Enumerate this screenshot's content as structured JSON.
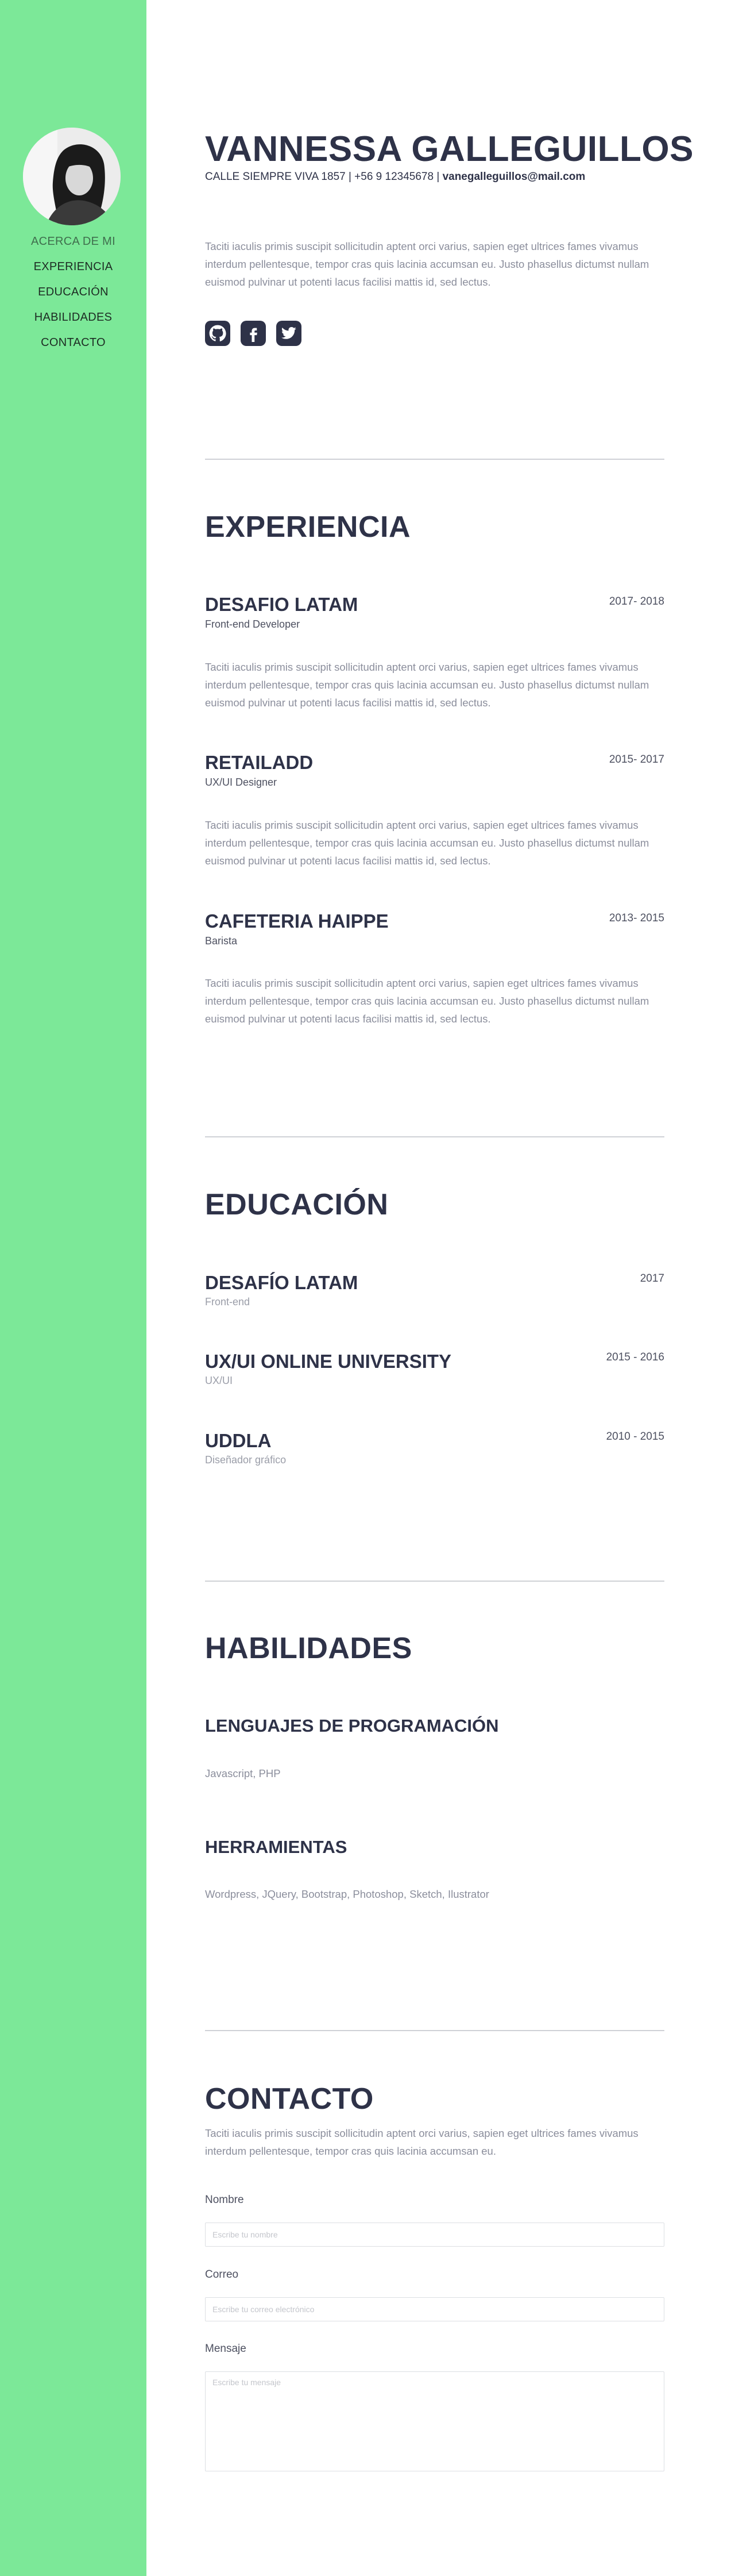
{
  "sidebar": {
    "nav": [
      {
        "label": "ACERCA DE MI"
      },
      {
        "label": "EXPERIENCIA"
      },
      {
        "label": "EDUCACIÓN"
      },
      {
        "label": "HABILIDADES"
      },
      {
        "label": "CONTACTO"
      }
    ],
    "bg_color": "#7ce898"
  },
  "header": {
    "name": "VANNESSA GALLEGUILLOS",
    "address": "CALLE SIEMPRE VIVA 1857",
    "sep1": " | ",
    "phone": "+56 9 12345678",
    "sep2": " | ",
    "email": "vanegalleguillos@mail.com",
    "bio": "Taciti iaculis primis suscipit sollicitudin aptent orci varius, sapien eget ultrices fames vivamus interdum pellentesque, tempor cras quis lacinia accumsan eu. Justo phasellus dictumst nullam euismod pulvinar ut potenti lacus facilisi mattis id, sed lectus.",
    "social_icons": [
      "github-icon",
      "facebook-icon",
      "twitter-icon"
    ]
  },
  "experience": {
    "title": "EXPERIENCIA",
    "items": [
      {
        "company": "DESAFIO LATAM",
        "role": "Front-end Developer",
        "dates": "2017- 2018",
        "description": "Taciti iaculis primis suscipit sollicitudin aptent orci varius, sapien eget ultrices fames vivamus interdum pellentesque, tempor cras quis lacinia accumsan eu. Justo phasellus dictumst nullam euismod pulvinar ut potenti lacus facilisi mattis id, sed lectus."
      },
      {
        "company": "RETAILADD",
        "role": "UX/UI Designer",
        "dates": "2015- 2017",
        "description": "Taciti iaculis primis suscipit sollicitudin aptent orci varius, sapien eget ultrices fames vivamus interdum pellentesque, tempor cras quis lacinia accumsan eu. Justo phasellus dictumst nullam euismod pulvinar ut potenti lacus facilisi mattis id, sed lectus."
      },
      {
        "company": "CAFETERIA HAIPPE",
        "role": "Barista",
        "dates": "2013- 2015",
        "description": "Taciti iaculis primis suscipit sollicitudin aptent orci varius, sapien eget ultrices fames vivamus interdum pellentesque, tempor cras quis lacinia accumsan eu. Justo phasellus dictumst nullam euismod pulvinar ut potenti lacus facilisi mattis id, sed lectus."
      }
    ]
  },
  "education": {
    "title": "EDUCACIÓN",
    "items": [
      {
        "school": "DESAFÍO LATAM",
        "field": "Front-end",
        "dates": "2017"
      },
      {
        "school": "UX/UI ONLINE UNIVERSITY",
        "field": "UX/UI",
        "dates": "2015 - 2016"
      },
      {
        "school": "UDDLA",
        "field": "Diseñador gráfico",
        "dates": "2010 - 2015"
      }
    ]
  },
  "skills": {
    "title": "HABILIDADES",
    "languages_title": "LENGUAJES DE PROGRAMACIÓN",
    "languages": "Javascript, PHP",
    "tools_title": "HERRAMIENTAS",
    "tools": "Wordpress, JQuery, Bootstrap, Photoshop, Sketch, Ilustrator"
  },
  "contact": {
    "title": "CONTACTO",
    "intro": "Taciti iaculis primis suscipit sollicitudin aptent orci varius, sapien eget ultrices fames vivamus interdum pellentesque, tempor cras quis lacinia accumsan eu.",
    "name_label": "Nombre",
    "name_placeholder": "Escribe tu nombre",
    "email_label": "Correo",
    "email_placeholder": "Escribe tu correo electrónico",
    "message_label": "Mensaje",
    "message_placeholder": "Escribe tu mensaje"
  },
  "colors": {
    "accent": "#7ce898",
    "text_dark": "#2e3248",
    "text_muted": "#8b8e9c"
  }
}
